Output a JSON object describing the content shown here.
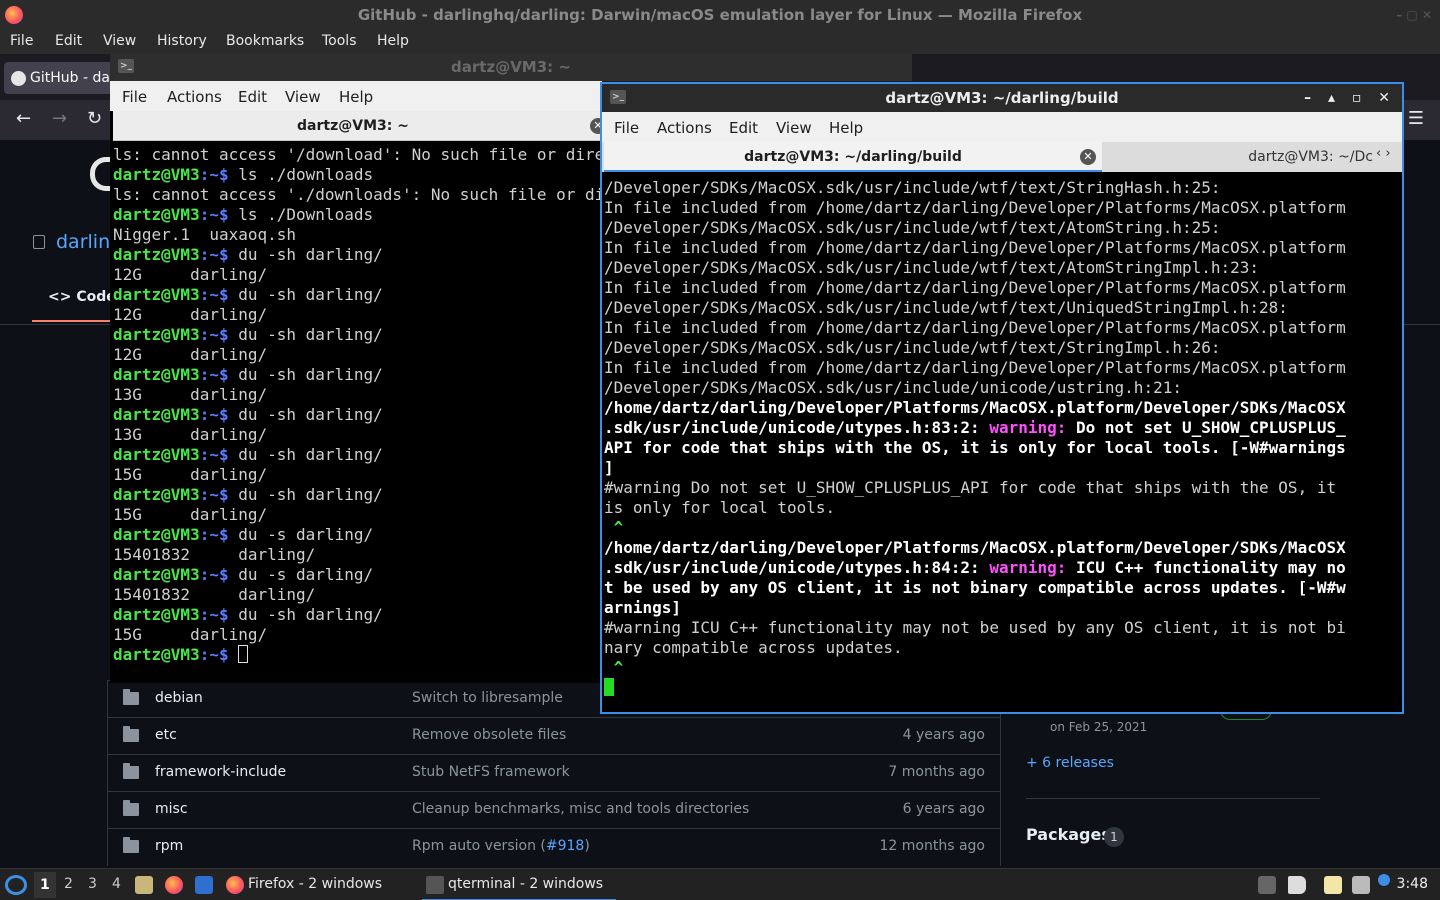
{
  "firefox": {
    "window_title": "GitHub - darlinghq/darling: Darwin/macOS emulation layer for Linux — Mozilla Firefox",
    "menu": [
      "File",
      "Edit",
      "View",
      "History",
      "Bookmarks",
      "Tools",
      "Help"
    ],
    "tab_label": "GitHub - darlinghq/darling",
    "nav": {
      "back": "←",
      "forward": "→",
      "reload": "↻",
      "menu": "☰"
    },
    "window_controls": "– ▢ ✕"
  },
  "github": {
    "repo_name": "darling",
    "code_tab": "<> Code",
    "files": [
      {
        "name": "debian",
        "message": "Switch to libresample",
        "link": "",
        "date": ""
      },
      {
        "name": "etc",
        "message": "Remove obsolete files",
        "link": "",
        "date": "4 years ago"
      },
      {
        "name": "framework-include",
        "message": "Stub NetFS framework",
        "link": "",
        "date": "7 months ago"
      },
      {
        "name": "misc",
        "message": "Cleanup benchmarks, misc and tools directories",
        "link": "",
        "date": "6 years ago"
      },
      {
        "name": "rpm",
        "message": "Rpm auto version (",
        "link": "#918",
        "suffix": ")",
        "date": "12 months ago"
      }
    ],
    "release_date": "on Feb 25, 2021",
    "releases_link": "+ 6 releases",
    "packages_heading": "Packages",
    "packages_count": "1"
  },
  "terminal_back": {
    "window_title": "dartz@VM3: ~",
    "menu": [
      "File",
      "Actions",
      "Edit",
      "View",
      "Help"
    ],
    "tab_label": "dartz@VM3: ~",
    "close_glyph": "✕",
    "prompt_user": "dartz@VM3",
    "prompt_path": ":~$ ",
    "lines": [
      {
        "type": "out",
        "text": "ls: cannot access '/download': No such file or directory"
      },
      {
        "type": "cmd",
        "text": "ls ./downloads"
      },
      {
        "type": "out",
        "text": "ls: cannot access './downloads': No such file or directory"
      },
      {
        "type": "cmd",
        "text": "ls ./Downloads"
      },
      {
        "type": "out",
        "text": "Nigger.1  uaxaoq.sh"
      },
      {
        "type": "cmd",
        "text": "du -sh darling/"
      },
      {
        "type": "out",
        "text": "12G\tdarling/"
      },
      {
        "type": "cmd",
        "text": "du -sh darling/"
      },
      {
        "type": "out",
        "text": "12G\tdarling/"
      },
      {
        "type": "cmd",
        "text": "du -sh darling/"
      },
      {
        "type": "out",
        "text": "12G\tdarling/"
      },
      {
        "type": "cmd",
        "text": "du -sh darling/"
      },
      {
        "type": "out",
        "text": "13G\tdarling/"
      },
      {
        "type": "cmd",
        "text": "du -sh darling/"
      },
      {
        "type": "out",
        "text": "13G\tdarling/"
      },
      {
        "type": "cmd",
        "text": "du -sh darling/"
      },
      {
        "type": "out",
        "text": "15G\tdarling/"
      },
      {
        "type": "cmd",
        "text": "du -sh darling/"
      },
      {
        "type": "out",
        "text": "15G\tdarling/"
      },
      {
        "type": "cmd",
        "text": "du -s darling/"
      },
      {
        "type": "out",
        "text": "15401832\tdarling/"
      },
      {
        "type": "cmd",
        "text": "du -s darling/"
      },
      {
        "type": "out",
        "text": "15401832\tdarling/"
      },
      {
        "type": "cmd",
        "text": "du -sh darling/"
      },
      {
        "type": "out",
        "text": "15G\tdarling/"
      },
      {
        "type": "prompt",
        "text": ""
      }
    ]
  },
  "terminal_front": {
    "window_title": "dartz@VM3: ~/darling/build",
    "menu": [
      "File",
      "Actions",
      "Edit",
      "View",
      "Help"
    ],
    "tab1_label": "dartz@VM3: ~/darling/build",
    "tab2_label": "dartz@VM3: ~/Dc",
    "close_glyph": "✕",
    "scroll_arrows": "‹ ›",
    "window_controls": "– ▴ ▫ ✕",
    "lines": [
      {
        "type": "plain",
        "text": "/Developer/SDKs/MacOSX.sdk/usr/include/wtf/text/StringHash.h:25:"
      },
      {
        "type": "plain",
        "text": "In file included from /home/dartz/darling/Developer/Platforms/MacOSX.platform"
      },
      {
        "type": "plain",
        "text": "/Developer/SDKs/MacOSX.sdk/usr/include/wtf/text/AtomString.h:25:"
      },
      {
        "type": "plain",
        "text": "In file included from /home/dartz/darling/Developer/Platforms/MacOSX.platform"
      },
      {
        "type": "plain",
        "text": "/Developer/SDKs/MacOSX.sdk/usr/include/wtf/text/AtomStringImpl.h:23:"
      },
      {
        "type": "plain",
        "text": "In file included from /home/dartz/darling/Developer/Platforms/MacOSX.platform"
      },
      {
        "type": "plain",
        "text": "/Developer/SDKs/MacOSX.sdk/usr/include/wtf/text/UniquedStringImpl.h:28:"
      },
      {
        "type": "plain",
        "text": "In file included from /home/dartz/darling/Developer/Platforms/MacOSX.platform"
      },
      {
        "type": "plain",
        "text": "/Developer/SDKs/MacOSX.sdk/usr/include/wtf/text/StringImpl.h:26:"
      },
      {
        "type": "plain",
        "text": "In file included from /home/dartz/darling/Developer/Platforms/MacOSX.platform"
      },
      {
        "type": "plain",
        "text": "/Developer/SDKs/MacOSX.sdk/usr/include/unicode/ustring.h:21:"
      },
      {
        "type": "bold",
        "text": "/home/dartz/darling/Developer/Platforms/MacOSX.platform/Developer/SDKs/MacOSX"
      },
      {
        "type": "warn",
        "pre": ".sdk/usr/include/unicode/utypes.h:83:2: ",
        "warn": "warning:",
        "post": " Do not set U_SHOW_CPLUSPLUS_"
      },
      {
        "type": "bold",
        "text": "API for code that ships with the OS, it is only for local tools. [-W#warnings"
      },
      {
        "type": "bold",
        "text": "]"
      },
      {
        "type": "plain",
        "text": "#warning Do not set U_SHOW_CPLUSPLUS_API for code that ships with the OS, it"
      },
      {
        "type": "plain",
        "text": "is only for local tools."
      },
      {
        "type": "caret",
        "text": " ^"
      },
      {
        "type": "bold",
        "text": "/home/dartz/darling/Developer/Platforms/MacOSX.platform/Developer/SDKs/MacOSX"
      },
      {
        "type": "warn",
        "pre": ".sdk/usr/include/unicode/utypes.h:84:2: ",
        "warn": "warning:",
        "post": " ICU C++ functionality may no"
      },
      {
        "type": "bold",
        "text": "t be used by any OS client, it is not binary compatible across updates. [-W#w"
      },
      {
        "type": "bold",
        "text": "arnings]"
      },
      {
        "type": "plain",
        "text": "#warning ICU C++ functionality may not be used by any OS client, it is not bi"
      },
      {
        "type": "plain",
        "text": "nary compatible across updates."
      },
      {
        "type": "caret",
        "text": " ^"
      },
      {
        "type": "cursor",
        "text": ""
      }
    ]
  },
  "taskbar": {
    "workspaces": [
      "1",
      "2",
      "3",
      "4"
    ],
    "firefox_task": "Firefox - 2 windows",
    "terminal_task": "qterminal - 2 windows",
    "clock": "3:48"
  }
}
